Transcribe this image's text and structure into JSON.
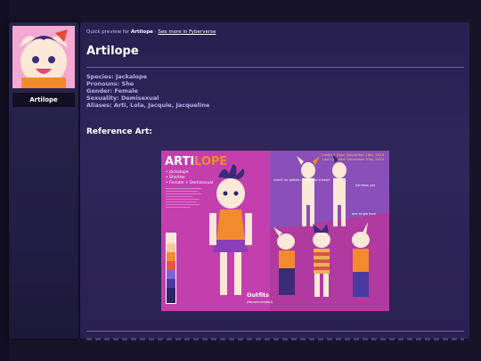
{
  "profile": {
    "name": "Artilope",
    "avatar_icon": "artilope-avatar-icon"
  },
  "breadcrumb": {
    "prefix": "Quick preview for",
    "name": "Artilope",
    "separator": "-",
    "link": "See more in Fyberverse"
  },
  "page_title": "Artilope",
  "info": {
    "species": "Species: Jackalope",
    "pronouns": "Pronouns: She",
    "gender": "Gender: Female",
    "sexuality": "Sexuality: Demisexual",
    "aliases": "Aliases: Arti, Lola, Jacquie, Jacqueline"
  },
  "reference_heading": "Reference Art:",
  "reference_sheet": {
    "title_part1": "ARTI",
    "title_part2": "LOPE",
    "bullets": [
      "• Jackalope",
      "• She/Her",
      "• Female + Demisexual"
    ],
    "creation_date": "Creation Date: November 18th, 2024",
    "last_updated": "Last Updated: December 31st, 2025",
    "note_cheek": "cheek fur pattern resembles a heart",
    "note_hornless": "hornless you",
    "note_horn": "one single horn",
    "outfits_label": "Outfits",
    "outfits_sub": "(Recommended)"
  },
  "colors": {
    "page_bg": "#17142a",
    "panel": "#2c2456",
    "accent_purple": "#b6aff0",
    "sheet_magenta": "#c43fae",
    "sheet_orange": "#f28a2e"
  }
}
